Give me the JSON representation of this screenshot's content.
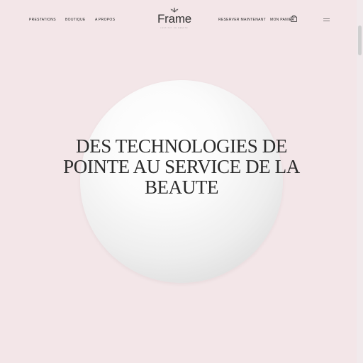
{
  "nav": {
    "prestations": "PRESTATIONS",
    "boutique": "BOUTIQUE",
    "apropos": "A PROPOS",
    "reserver": "RESERVER MAINTENANT",
    "panier": "MON PANIER"
  },
  "logo": {
    "name": "Frame",
    "subtitle": "INSTITUT DE BEAUTE"
  },
  "hero": {
    "title": "DES TECHNOLOGIES DE POINTE AU SERVICE DE LA BEAUTE"
  },
  "icons": {
    "bag": "shopping-bag-icon",
    "menu": "hamburger-menu-icon",
    "logo_mark": "lotus-icon"
  },
  "colors": {
    "background": "#f3e6e8",
    "text": "#2a2a2a",
    "sphere": "#f5f5f5"
  }
}
